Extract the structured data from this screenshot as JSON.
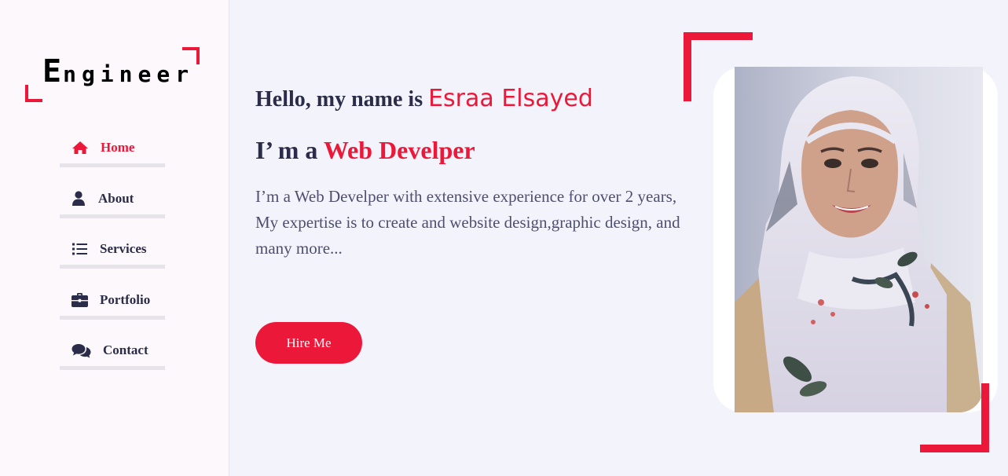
{
  "logo": {
    "initial": "E",
    "rest": "ngineer"
  },
  "nav": [
    {
      "label": "Home",
      "icon": "home-icon",
      "active": true
    },
    {
      "label": "About",
      "icon": "user-icon",
      "active": false
    },
    {
      "label": "Services",
      "icon": "list-icon",
      "active": false
    },
    {
      "label": "Portfolio",
      "icon": "briefcase-icon",
      "active": false
    },
    {
      "label": "Contact",
      "icon": "comments-icon",
      "active": false
    }
  ],
  "hero": {
    "greeting": "Hello, my name is ",
    "name": "Esraa Elsayed",
    "role_prefix": "I’ m a ",
    "role": "Web Develper",
    "description": "I’m a Web Develper with extensive experience for over 2 years, My expertise is to create and website design,graphic design, and many more...",
    "cta_label": "Hire Me"
  },
  "colors": {
    "accent": "#ec1839",
    "dark_text": "#2b2c49",
    "body_text": "#504e70",
    "sidebar_bg": "#fdf8fc",
    "main_bg": "#f3f3fb"
  },
  "profile_photo": {
    "icon": "profile-photo"
  }
}
